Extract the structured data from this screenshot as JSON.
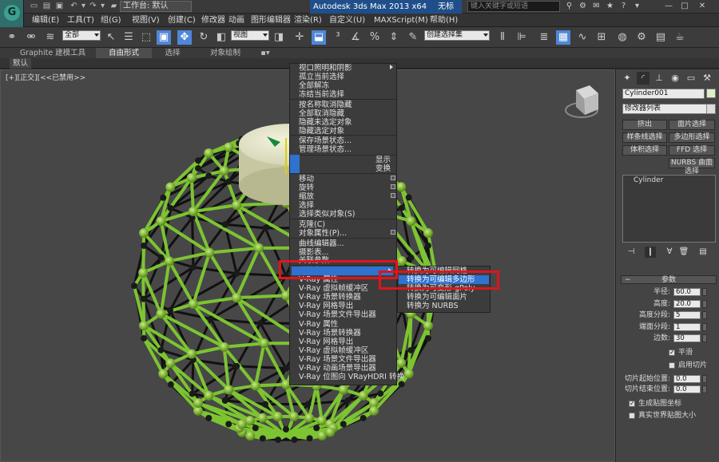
{
  "titlebar": {
    "workspace": "工作台: 默认",
    "app_title": "Autodesk 3ds Max  2013 x64",
    "file_title": "无标题",
    "search_placeholder": "键入关键字或短语"
  },
  "menubar": [
    "编辑(E)",
    "工具(T)",
    "组(G)",
    "视图(V)",
    "创建(C)",
    "修改器",
    "动画",
    "图形编辑器",
    "渲染(R)",
    "自定义(U)",
    "MAXScript(M)",
    "帮助(H)"
  ],
  "toolbar": {
    "selection_filter": "全部",
    "reference_coord": "视图",
    "named_selection": "创建选择集"
  },
  "ribbon": {
    "tabs": [
      "Graphite 建模工具",
      "自由形式",
      "选择",
      "对象绘制"
    ],
    "active_tab": "自由形式",
    "sub": "默认"
  },
  "viewport": {
    "label": "[+][正交][<<已禁用>>"
  },
  "context_menu": {
    "items": [
      "视口照明和阴影",
      "孤立当前选择",
      "全部解冻",
      "冻结当前选择",
      "按名称取消隐藏",
      "全部取消隐藏",
      "隐藏未选定对象",
      "隐藏选定对象",
      "保存场景状态...",
      "管理场景状态..."
    ],
    "quad_headers": [
      "显示",
      "变换"
    ],
    "transform": [
      "移动",
      "旋转",
      "缩放",
      "选择",
      "选择类似对象(S)"
    ],
    "edit": [
      "克隆(C)",
      "对象属性(P)..."
    ],
    "lower": [
      "曲线编辑器...",
      "摄影表...",
      "关联参数..."
    ],
    "convert": "转换为:",
    "vray": [
      "V-Ray 属性",
      "V-Ray 虚拟帧缓冲区",
      "V-Ray 场景转换器",
      "V-Ray 网格导出",
      "V-Ray 场景文件导出器",
      "V-Ray 属性",
      "V-Ray 场景转换器",
      "V-Ray 网格导出",
      "V-Ray 虚拟帧缓冲区",
      "V-Ray 场景文件导出器",
      "V-Ray 动画场景导出器",
      "V-Ray 位图向 VRayHDRI 转换"
    ]
  },
  "submenu": {
    "items": [
      "转换为可编辑网格",
      "转换为可编辑多边形",
      "转换为可变形 gPoly",
      "转换为可编辑面片",
      "转换为 NURBS"
    ],
    "highlighted_index": 1
  },
  "command_panel": {
    "object_name": "Cylinder001",
    "object_color": "#dcefc7",
    "modifier_list": "修改器列表",
    "buttons": [
      "挤出",
      "面片选择",
      "样条线选择",
      "多边形选择",
      "体积选择",
      "FFD 选择",
      "NURBS 曲面选择"
    ],
    "stack_item": "Cylinder",
    "rollout_title": "参数",
    "params": [
      {
        "label": "半径:",
        "value": "60.0"
      },
      {
        "label": "高度:",
        "value": "20.0"
      },
      {
        "label": "高度分段:",
        "value": "5"
      },
      {
        "label": "端面分段:",
        "value": "1"
      },
      {
        "label": "边数:",
        "value": "30"
      }
    ],
    "smooth_label": "平滑",
    "smooth_checked": true,
    "slice_label": "启用切片",
    "slice_checked": false,
    "slice_from_label": "切片起始位置:",
    "slice_from": "0.0",
    "slice_to_label": "切片结束位置:",
    "slice_to": "0.0",
    "gen_uv_label": "生成贴图坐标",
    "gen_uv_checked": true,
    "real_world_label": "真实世界贴图大小",
    "real_world_checked": false
  },
  "colors": {
    "highlight": "#2f72d0",
    "annotation_red": "#e0141c",
    "wire_green": "#7cc431",
    "viewport_bg": "#474747"
  }
}
